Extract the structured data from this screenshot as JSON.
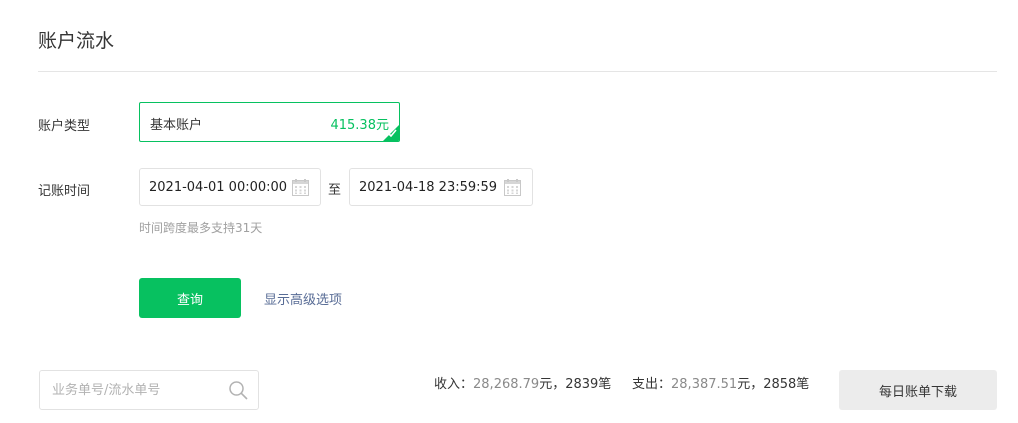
{
  "page": {
    "title": "账户流水"
  },
  "account": {
    "label": "账户类型",
    "name": "基本账户",
    "balance_number": "415.38",
    "balance_unit": "元",
    "accent_color": "#07c160"
  },
  "time": {
    "label": "记账时间",
    "start": "2021-04-01 00:00:00",
    "separator": "至",
    "end": "2021-04-18 23:59:59",
    "hint": "时间跨度最多支持31天"
  },
  "actions": {
    "query_label": "查询",
    "advanced_label": "显示高级选项"
  },
  "search": {
    "placeholder": "业务单号/流水单号",
    "icon": "search-icon"
  },
  "summary": {
    "income_label": "收入：",
    "income_amount": "28,268.79",
    "income_unit_count": "元，2839笔",
    "expense_label": "支出：",
    "expense_amount": "28,387.51",
    "expense_unit_count": "元，2858笔"
  },
  "download": {
    "label": "每日账单下载"
  }
}
